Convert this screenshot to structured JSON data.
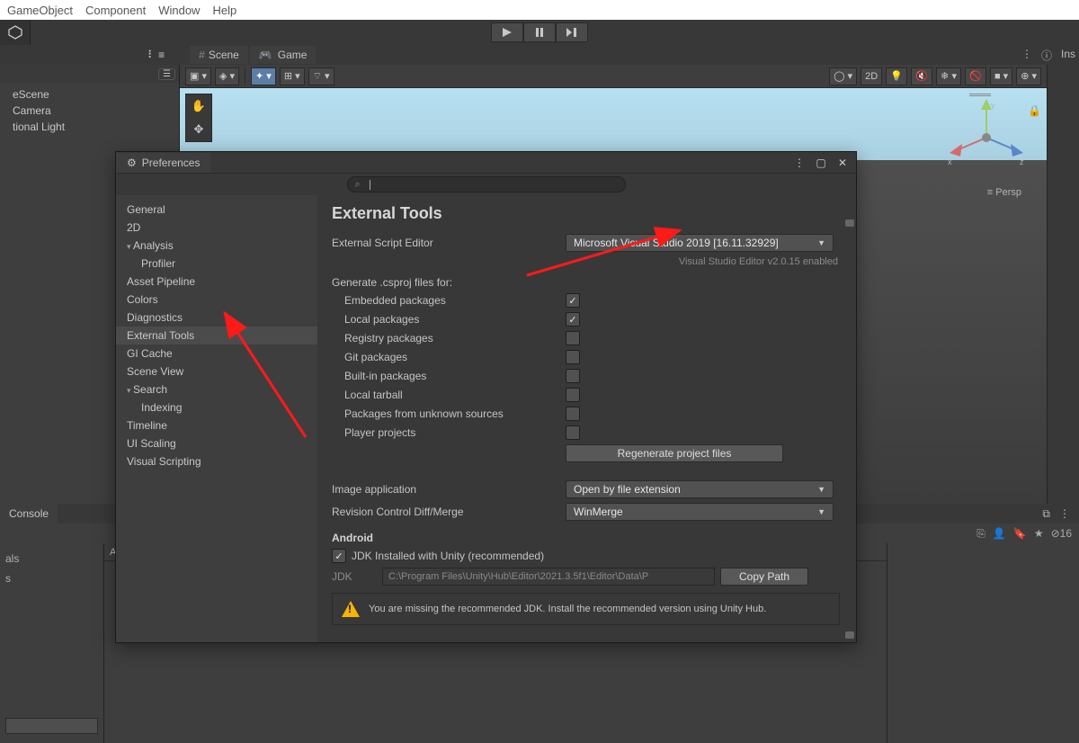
{
  "menu": {
    "items": [
      "GameObject",
      "Component",
      "Window",
      "Help"
    ]
  },
  "hierarchy": {
    "items": [
      "eScene",
      "Camera",
      "tional Light"
    ]
  },
  "sceneTabs": {
    "scene": "Scene",
    "game": "Game"
  },
  "sceneToolbar": {
    "twoD": "2D"
  },
  "persp": "Persp",
  "inspector": {
    "label": "Ins"
  },
  "console": {
    "tab": "Console",
    "leftItems": [
      "als",
      "s"
    ],
    "assetsLabel": "As",
    "countBadge": "16"
  },
  "prefs": {
    "title": "Preferences",
    "searchPlaceholder": "",
    "side": {
      "general": "General",
      "twoD": "2D",
      "analysis": "Analysis",
      "profiler": "Profiler",
      "assetPipeline": "Asset Pipeline",
      "colors": "Colors",
      "diagnostics": "Diagnostics",
      "externalTools": "External Tools",
      "giCache": "GI Cache",
      "sceneView": "Scene View",
      "search": "Search",
      "indexing": "Indexing",
      "timeline": "Timeline",
      "uiScaling": "UI Scaling",
      "visualScripting": "Visual Scripting"
    },
    "content": {
      "heading": "External Tools",
      "externalScriptEditorLabel": "External Script Editor",
      "externalScriptEditorValue": "Microsoft Visual Studio 2019 [16.11.32929]",
      "editorNote": "Visual Studio Editor v2.0.15 enabled",
      "csprojHeader": "Generate .csproj files for:",
      "csproj": {
        "embedded": "Embedded packages",
        "local": "Local packages",
        "registry": "Registry packages",
        "git": "Git packages",
        "builtin": "Built-in packages",
        "tarball": "Local tarball",
        "unknown": "Packages from unknown sources",
        "player": "Player projects"
      },
      "regenBtn": "Regenerate project files",
      "imageAppLabel": "Image application",
      "imageAppValue": "Open by file extension",
      "revisionLabel": "Revision Control Diff/Merge",
      "revisionValue": "WinMerge",
      "androidHeader": "Android",
      "jdkChkLabel": "JDK Installed with Unity (recommended)",
      "jdkLabel": "JDK",
      "jdkPath": "C:\\Program Files\\Unity\\Hub\\Editor\\2021.3.5f1\\Editor\\Data\\P",
      "copyPath": "Copy Path",
      "warn": "You are missing the recommended JDK. Install the recommended version using Unity Hub."
    }
  }
}
